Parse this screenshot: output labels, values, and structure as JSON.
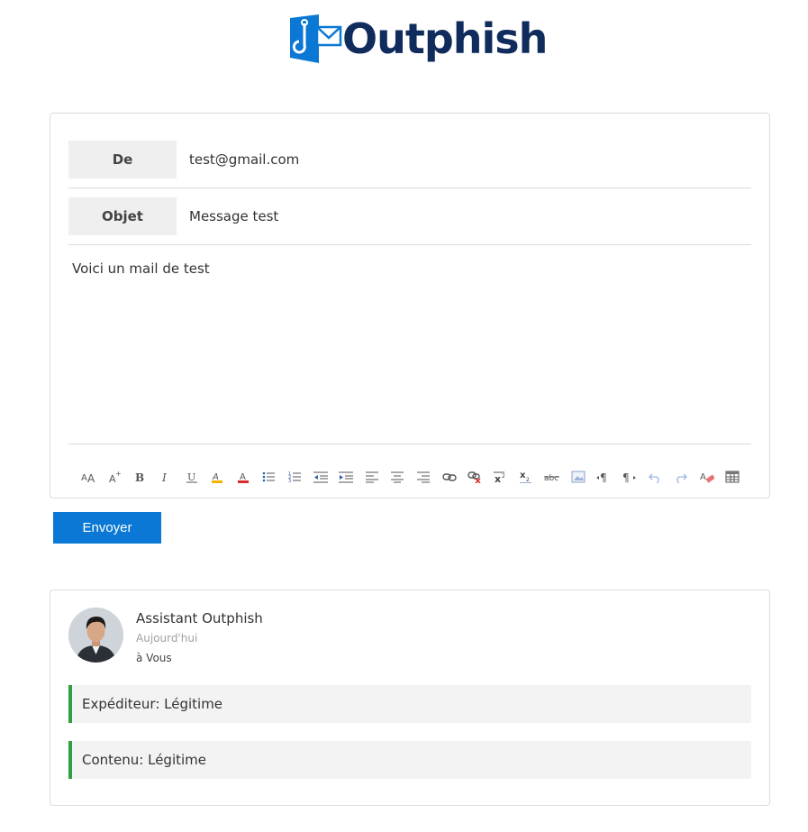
{
  "brand": {
    "name": "Outphish",
    "primary_color": "#0a78d4",
    "text_color": "#0f2c5c"
  },
  "compose": {
    "from_label": "De",
    "from_value": "test@gmail.com",
    "subject_label": "Objet",
    "subject_value": "Message test",
    "body": "Voici un mail de test",
    "toolbar_icons": [
      "font-size-icon",
      "increase-font-icon",
      "bold-icon",
      "italic-icon",
      "underline-icon",
      "highlight-icon",
      "font-color-icon",
      "bullet-list-icon",
      "numbered-list-icon",
      "outdent-icon",
      "indent-icon",
      "align-left-icon",
      "align-center-icon",
      "align-right-icon",
      "link-icon",
      "unlink-icon",
      "superscript-icon",
      "subscript-icon",
      "strikethrough-icon",
      "image-icon",
      "ltr-icon",
      "rtl-icon",
      "undo-icon",
      "redo-icon",
      "clear-format-icon",
      "table-icon"
    ]
  },
  "send_button": "Envoyer",
  "result": {
    "sender": "Assistant Outphish",
    "date": "Aujourd'hui",
    "recipient": "à Vous",
    "verdicts": [
      {
        "text": "Expéditeur: Légitime",
        "color": "#2ea043"
      },
      {
        "text": "Contenu: Légitime",
        "color": "#2ea043"
      }
    ]
  }
}
